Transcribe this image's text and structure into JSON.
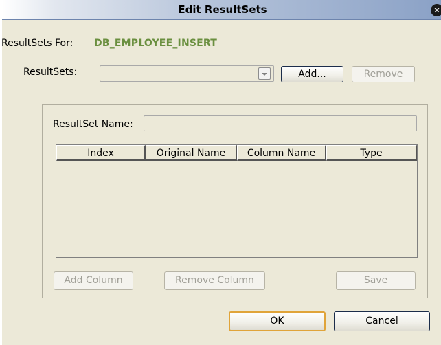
{
  "window": {
    "title": "Edit ResultSets"
  },
  "header": {
    "resultsets_for_label": "ResultSets For:",
    "resultsets_for_value": "DB_EMPLOYEE_INSERT"
  },
  "resultsets": {
    "label": "ResultSets:",
    "selected_value": "",
    "add_label": "Add...",
    "remove_label": "Remove"
  },
  "details": {
    "name_label": "ResultSet Name:",
    "name_value": "",
    "columns": [
      "Index",
      "Original Name",
      "Column Name",
      "Type"
    ],
    "rows": [],
    "add_column_label": "Add Column",
    "remove_column_label": "Remove Column",
    "save_label": "Save"
  },
  "footer": {
    "ok_label": "OK",
    "cancel_label": "Cancel"
  }
}
